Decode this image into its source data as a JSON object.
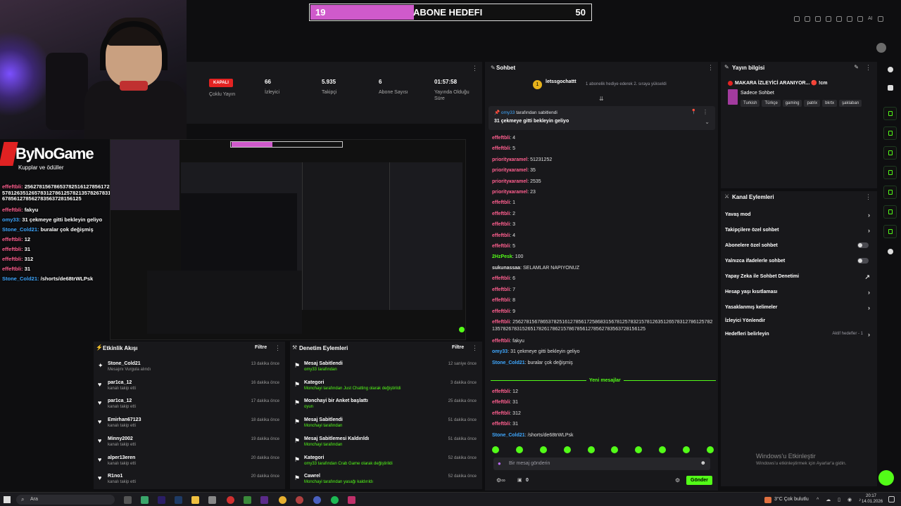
{
  "goal": {
    "current": "19",
    "title": "ABONE HEDEFI",
    "max": "50",
    "progress": 0.37
  },
  "overlay": {
    "brand": "ByNoGame",
    "sub": "Kupplar ve ödüller",
    "chat": [
      {
        "user": "effeftbli:",
        "text": "256278156786537825161278561725868315678125783215781263512657831278612578213578267831526517826178621578678561278562783563728156125",
        "wrap": true
      },
      {
        "user": "effeftbli:",
        "text": "fakyu"
      },
      {
        "user": "omy33:",
        "text": "31 çekmeye gitti bekleyin geliyo",
        "blue": true
      },
      {
        "user": "Stone_Cold21:",
        "text": "buralar çok değişmiş",
        "blue": true
      },
      {
        "user": "effeftbli:",
        "text": "12"
      },
      {
        "user": "effeftbli:",
        "text": "31"
      },
      {
        "user": "effeftbli:",
        "text": "312"
      },
      {
        "user": "effeftbli:",
        "text": "31"
      },
      {
        "user": "Stone_Cold21:",
        "text": "/shorts/de68trWLPsk",
        "blue": true
      }
    ]
  },
  "stats": {
    "status": "KAPALI",
    "status_label": "Çoklu Yayın",
    "viewers": "66",
    "viewers_label": "İzleyici",
    "followers": "5.935",
    "followers_label": "Takipçi",
    "subs": "6",
    "subs_label": "Abone Sayısı",
    "duration": "01:57:58",
    "duration_label": "Yayında Olduğu Süre"
  },
  "chat": {
    "title": "Sohbet",
    "top_user": "letssgochattt",
    "top_note": "1 abonelik hediye ederek 2. sıraya yükseldi",
    "pinned_by": "omy33",
    "pinned_by_suffix": "tarafından sabitlendi",
    "pinned_text": "31 çekmeye gitti bekleyin geliyo",
    "new_messages": "Yeni mesajlar",
    "input_placeholder": "Bir mesaj gönderin",
    "send": "Gönder",
    "count": "0",
    "messages": [
      {
        "u": "effeftbli",
        "c": "pink",
        "t": "4"
      },
      {
        "u": "effeftbli",
        "c": "pink",
        "t": "5"
      },
      {
        "u": "priorityкaramel",
        "c": "pink",
        "t": "51231252"
      },
      {
        "u": "priorityкaramel",
        "c": "pink",
        "t": "35"
      },
      {
        "u": "priorityкaramel",
        "c": "pink",
        "t": "2535"
      },
      {
        "u": "priorityкaramel",
        "c": "pink",
        "t": "23"
      },
      {
        "u": "effeftbli",
        "c": "pink",
        "t": "1"
      },
      {
        "u": "effeftbli",
        "c": "pink",
        "t": "2"
      },
      {
        "u": "effeftbli",
        "c": "pink",
        "t": "3"
      },
      {
        "u": "effeftbli",
        "c": "pink",
        "t": "4"
      },
      {
        "u": "effeftbli",
        "c": "pink",
        "t": "5"
      },
      {
        "u": "2HzPesk",
        "c": "green",
        "t": "100"
      },
      {
        "u": "sukunassaa",
        "c": "white",
        "t": "SELAMLAR NAPIYONUZ"
      },
      {
        "u": "effeftbli",
        "c": "pink",
        "t": "6"
      },
      {
        "u": "effeftbli",
        "c": "pink",
        "t": "7"
      },
      {
        "u": "effeftbli",
        "c": "pink",
        "t": "8"
      },
      {
        "u": "effeftbli",
        "c": "pink",
        "t": "9"
      },
      {
        "u": "effeftbli",
        "c": "pink",
        "t": "256278156786537825161278561725868315678125783215781263512657831278612578213578267831526517826178621578678561278562783563728156125",
        "wrap": true
      },
      {
        "u": "effeftbli",
        "c": "pink",
        "t": "fakyu"
      },
      {
        "u": "omy33",
        "c": "blue",
        "t": "31 çekmeye gitti bekleyin geliyo"
      },
      {
        "u": "Stone_Cold21",
        "c": "blue",
        "t": "buralar çok değişmiş"
      }
    ],
    "after": [
      {
        "u": "effeftbli",
        "c": "pink",
        "t": "12"
      },
      {
        "u": "effeftbli",
        "c": "pink",
        "t": "31"
      },
      {
        "u": "effeftbli",
        "c": "pink",
        "t": "312"
      },
      {
        "u": "effeftbli",
        "c": "pink",
        "t": "31"
      },
      {
        "u": "Stone_Cold21",
        "c": "blue",
        "t": "/shorts/de68trWLPsk"
      }
    ]
  },
  "info": {
    "title": "Yayın bilgisi",
    "stream_title": "MAKARA İZLEYİCİ ARANIYOR... 🔴 !cm",
    "category": "Sadece Sohbet",
    "tags": [
      "Turkish",
      "Türkçe",
      "gaming",
      "patrix",
      "bkrtx",
      "şaklaban"
    ]
  },
  "actions": {
    "title": "Kanal Eylemleri",
    "items": [
      {
        "label": "Yavaş mod",
        "kind": "chev"
      },
      {
        "label": "Takipçilere özel sohbet",
        "kind": "chev"
      },
      {
        "label": "Abonelere özel sohbet",
        "kind": "toggle"
      },
      {
        "label": "Yalnızca ifadelerle sohbet",
        "kind": "toggle"
      },
      {
        "label": "Yapay Zeka ile Sohbet Denetimi",
        "kind": "ext"
      },
      {
        "label": "Hesap yaşı kısıtlaması",
        "kind": "chev"
      },
      {
        "label": "Yasaklanmış kelimeler",
        "kind": "chev"
      },
      {
        "label": "İzleyici Yönlendir",
        "kind": "none"
      },
      {
        "label": "Hedefleri belirleyin",
        "kind": "chev",
        "extra": "Aktif hedefler - 1"
      }
    ]
  },
  "activity": {
    "title": "Etkinlik Akışı",
    "filter": "Filtre",
    "rows": [
      {
        "name": "Stone_Cold21",
        "sub": "Mesajını Vurgula alındı",
        "time": "13 dakika önce"
      },
      {
        "name": "par1ca_12",
        "sub": "kanalı takip etti",
        "time": "16 dakika önce"
      },
      {
        "name": "par1ca_12",
        "sub": "kanalı takip etti",
        "time": "17 dakika önce"
      },
      {
        "name": "Emirhan67123",
        "sub": "kanalı takip etti",
        "time": "18 dakika önce"
      },
      {
        "name": "Minny2002",
        "sub": "kanalı takip etti",
        "time": "19 dakika önce"
      },
      {
        "name": "alper13eren",
        "sub": "kanalı takip etti",
        "time": "20 dakika önce"
      },
      {
        "name": "R1no1",
        "sub": "kanalı takip etti",
        "time": "20 dakika önce"
      }
    ]
  },
  "moderation": {
    "title": "Denetim Eylemleri",
    "filter": "Filtre",
    "rows": [
      {
        "name": "Mesaj Sabitlendi",
        "sub": "omy33 tarafından",
        "time": "12 saniye önce"
      },
      {
        "name": "Kategori",
        "sub": "Monchayi tarafından Just Chatting olarak değiştirildi",
        "time": "3 dakika önce"
      },
      {
        "name": "Monchayi bir Anket başlattı",
        "sub": "oyun",
        "time": "25 dakika önce"
      },
      {
        "name": "Mesaj Sabitlendi",
        "sub": "Monchayi tarafından",
        "time": "51 dakika önce"
      },
      {
        "name": "Mesaj Sabitlemesi Kaldırıldı",
        "sub": "Monchayi tarafından",
        "time": "51 dakika önce"
      },
      {
        "name": "Kategori",
        "sub": "omy33 tarafından Crab Game olarak değiştirildi",
        "time": "52 dakika önce"
      },
      {
        "name": "Cawrel",
        "sub": "Monchayi tarafından yasağı kaldırıldı",
        "time": "52 dakika önce"
      }
    ]
  },
  "windows": {
    "activate": "Windows'u Etkinleştir",
    "activate_sub": "Windows'u etkinleştirmek için Ayarlar'a gidin."
  },
  "taskbar": {
    "search": "Ara",
    "weather": "3°C  Çok bulutlu",
    "time": "20:17",
    "date": "14.01.2026"
  },
  "colors": {
    "accent": "#53fc18",
    "goal": "#cf5acb",
    "panel": "#18181b"
  }
}
